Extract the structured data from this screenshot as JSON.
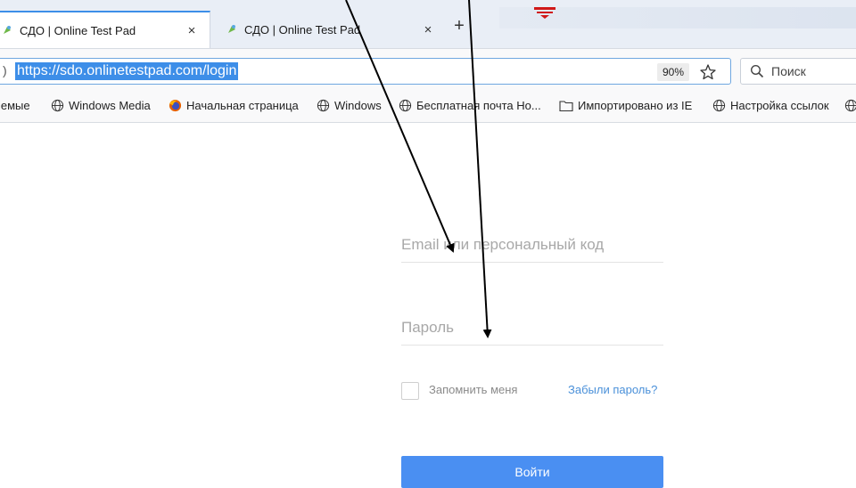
{
  "browser": {
    "tabs": [
      {
        "title": "СДО | Online Test Pad",
        "close": "×",
        "active": true
      },
      {
        "title": "СДО | Online Test Pad",
        "close": "×",
        "active": false
      }
    ],
    "new_tab": "+",
    "url": "https://sdo.onlinetestpad.com/login",
    "url_left_edge": ")",
    "zoom": "90%",
    "search_placeholder": "Поиск",
    "bookmarks": [
      {
        "label": "іемые",
        "icon": "none"
      },
      {
        "label": "Windows Media",
        "icon": "globe-icon"
      },
      {
        "label": "Начальная страница",
        "icon": "firefox-icon"
      },
      {
        "label": "Windows",
        "icon": "globe-icon"
      },
      {
        "label": "Бесплатная почта Но...",
        "icon": "globe-icon"
      },
      {
        "label": "Импортировано из IE",
        "icon": "folder-icon"
      },
      {
        "label": "Настройка ссылок",
        "icon": "globe-icon"
      }
    ]
  },
  "login": {
    "email_placeholder": "Email или персональный код",
    "password_placeholder": "Пароль",
    "remember_label": "Запомнить меня",
    "forgot_label": "Забыли пароль?",
    "submit_label": "Войти"
  },
  "colors": {
    "accent": "#4a8ff2",
    "link": "#4a90d9",
    "url_highlight": "#3d8ee8"
  }
}
